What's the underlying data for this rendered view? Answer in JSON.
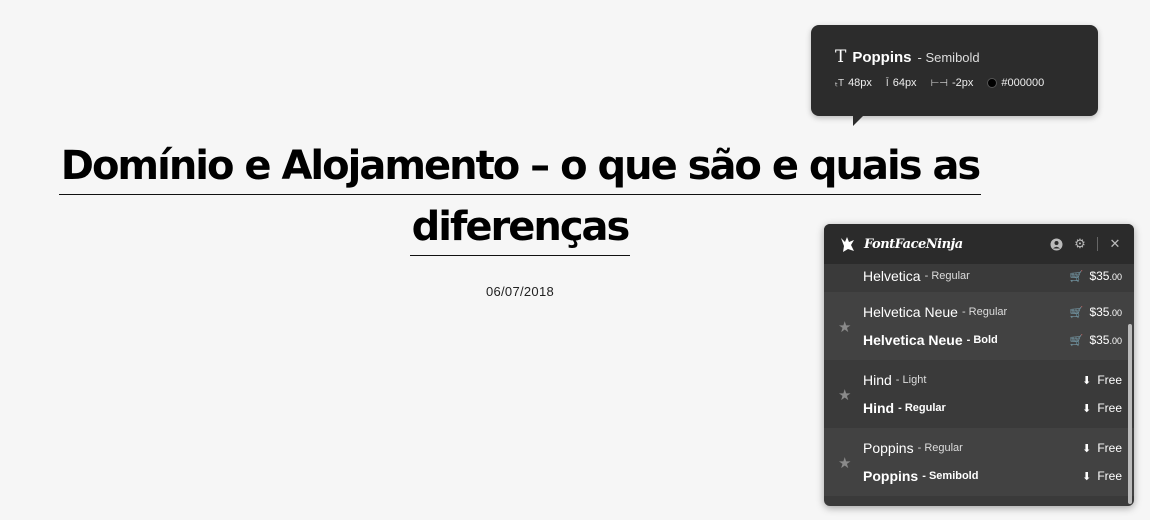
{
  "article": {
    "title_line1": "Domínio e Alojamento – o que são e quais as",
    "title_line2": "diferenças",
    "date": "06/07/2018"
  },
  "tooltip": {
    "family": "Poppins",
    "style": "- Semibold",
    "size": "48px",
    "line_height": "64px",
    "letter_spacing": "-2px",
    "color_hex": "#000000",
    "color": "#000000"
  },
  "panel": {
    "brand": "FontFaceNinja",
    "fonts": [
      {
        "group": 0,
        "name": "Helvetica",
        "style": "- Regular",
        "price": "$35",
        "cents": ".00",
        "bold": false,
        "kind": "buy"
      },
      {
        "group": 1,
        "name": "Helvetica Neue",
        "style": "- Regular",
        "price": "$35",
        "cents": ".00",
        "bold": false,
        "kind": "buy"
      },
      {
        "group": 1,
        "name": "Helvetica Neue",
        "style": "- Bold",
        "price": "$35",
        "cents": ".00",
        "bold": true,
        "kind": "buy"
      },
      {
        "group": 2,
        "name": "Hind",
        "style": "- Light",
        "price": "Free",
        "cents": "",
        "bold": false,
        "kind": "free"
      },
      {
        "group": 2,
        "name": "Hind",
        "style": "- Regular",
        "price": "Free",
        "cents": "",
        "bold": true,
        "kind": "free"
      },
      {
        "group": 3,
        "name": "Poppins",
        "style": "- Regular",
        "price": "Free",
        "cents": "",
        "bold": false,
        "kind": "free"
      },
      {
        "group": 3,
        "name": "Poppins",
        "style": "- Semibold",
        "price": "Free",
        "cents": "",
        "bold": true,
        "kind": "free"
      }
    ]
  },
  "colors": {
    "panel_bg": "#3a3a3a",
    "panel_alt": "#424242",
    "tooltip_bg": "#2c2c2c",
    "page_bg": "#f6f6f6"
  }
}
